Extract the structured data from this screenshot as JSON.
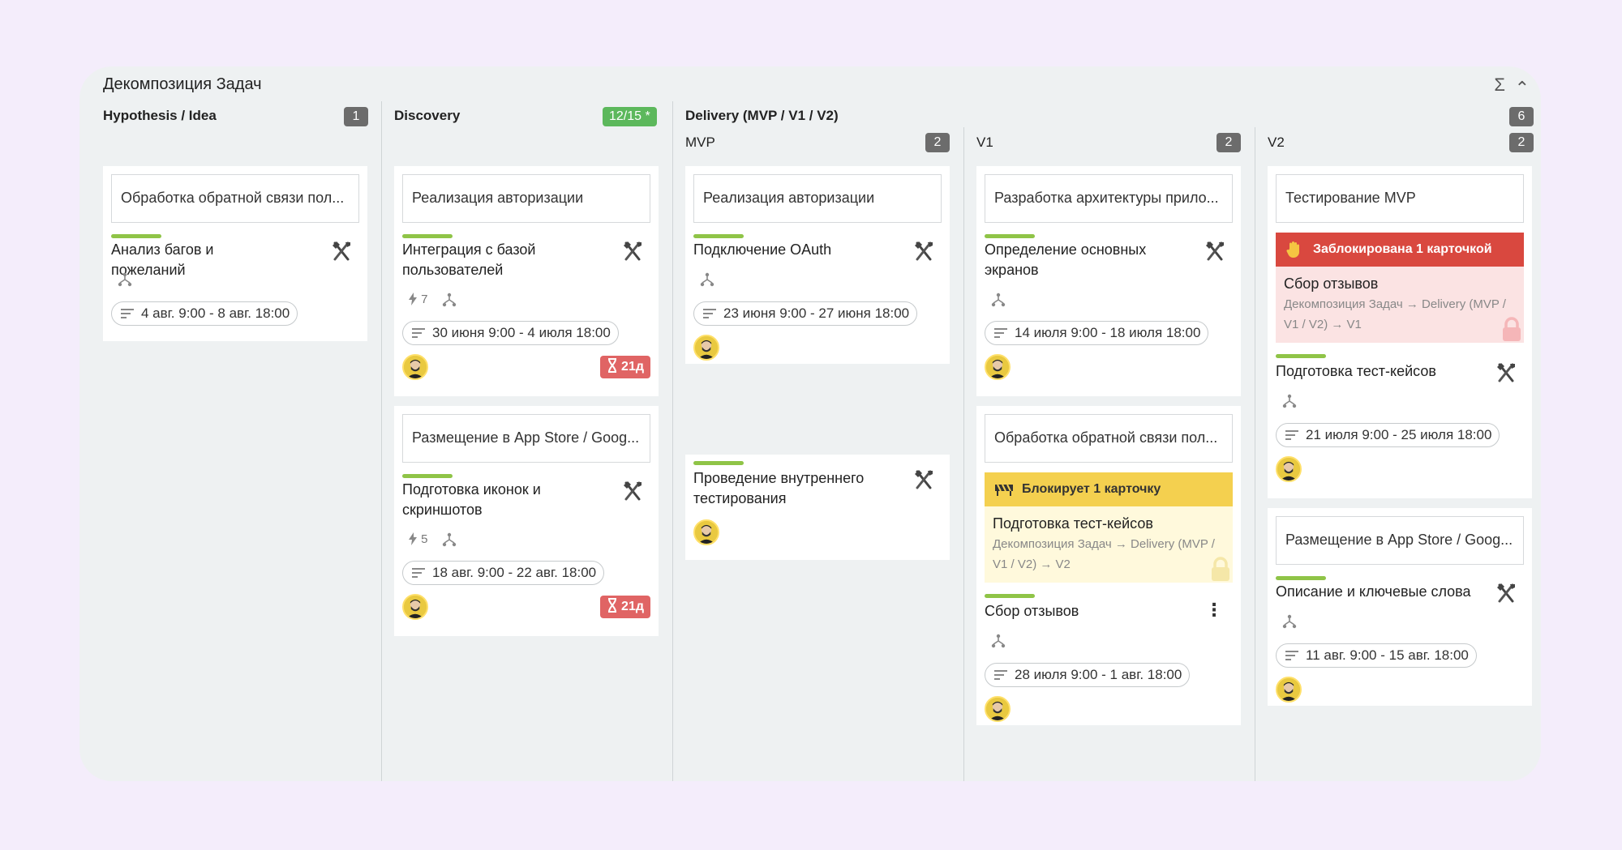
{
  "board": {
    "title": "Декомпозиция Задач"
  },
  "header_icons": {
    "sigma": "Σ",
    "collapse": "⌃"
  },
  "columns": {
    "hypothesis": {
      "title": "Hypothesis / Idea",
      "count": "1"
    },
    "discovery": {
      "title": "Discovery",
      "count": "12/15 *"
    },
    "delivery": {
      "title": "Delivery (MVP / V1 / V2)",
      "count": "6",
      "mvp": {
        "title": "MVP",
        "count": "2"
      },
      "v1": {
        "title": "V1",
        "count": "2"
      },
      "v2": {
        "title": "V2",
        "count": "2"
      }
    }
  },
  "cards": {
    "hyp1": {
      "parent": "Обработка обратной связи пол...",
      "title": "Анализ багов и пожеланий",
      "dates": "4 авг. 9:00 - 8 авг. 18:00"
    },
    "dis1": {
      "parent": "Реализация авторизации",
      "title": "Интеграция с базой пользователей",
      "flash": "7",
      "dates": "30 июня 9:00 - 4 июля 18:00",
      "overdue": "21д"
    },
    "dis2": {
      "parent": "Размещение в App Store / Goog...",
      "title": "Подготовка иконок и скриншотов",
      "flash": "5",
      "dates": "18 авг. 9:00 - 22 авг. 18:00",
      "overdue": "21д"
    },
    "mvp1": {
      "parent": "Реализация авторизации",
      "title": "Подключение OAuth",
      "dates": "23 июня 9:00 - 27 июня 18:00"
    },
    "mvp2": {
      "title": "Проведение внутреннего тестирования"
    },
    "v1a": {
      "parent": "Разработка архитектуры прило...",
      "title": "Определение основных экранов",
      "dates": "14 июля 9:00 - 18 июля 18:00"
    },
    "v1b": {
      "parent": "Обработка обратной связи пол...",
      "banner": "Блокирует 1 карточку",
      "blocked_title": "Подготовка тест-кейсов",
      "blocked_path": "Декомпозиция Задач → Delivery (MVP / V1 / V2) → V2",
      "title": "Сбор отзывов",
      "dates": "28 июля 9:00 - 1 авг. 18:00"
    },
    "v2a": {
      "parent": "Тестирование MVP",
      "banner": "Заблокирована 1 карточкой",
      "blocked_title": "Сбор отзывов",
      "blocked_path": "Декомпозиция Задач → Delivery (MVP / V1 / V2) → V1",
      "title": "Подготовка тест-кейсов",
      "dates": "21 июля 9:00 - 25 июля 18:00"
    },
    "v2b": {
      "parent": "Размещение в App Store / Goog...",
      "title": "Описание и ключевые слова",
      "dates": "11 авг. 9:00 - 15 авг. 18:00"
    }
  },
  "colors": {
    "board_bg": "#eef1f2",
    "progress": "#8fc447",
    "overdue": "#e06464",
    "blocked_red": "#d9483f",
    "blocks_yellow": "#f4d04f",
    "badge_green": "#5cb85c"
  }
}
